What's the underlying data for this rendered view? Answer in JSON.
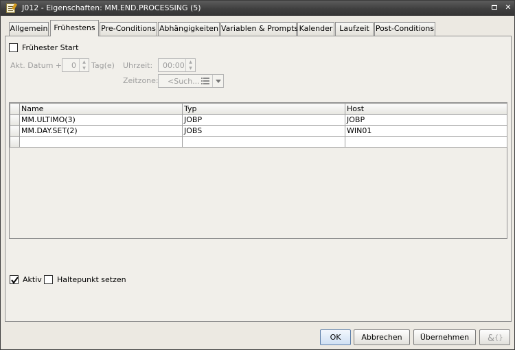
{
  "window": {
    "title": "J012 - Eigenschaften: MM.END.PROCESSING (5)",
    "close_glyph": "✕"
  },
  "tabs": [
    {
      "label": "Allgemein",
      "active": false
    },
    {
      "label": "Frühestens",
      "active": true
    },
    {
      "label": "Pre-Conditions",
      "active": false
    },
    {
      "label": "Abhängigkeiten",
      "active": false
    },
    {
      "label": "Variablen & Prompts",
      "active": false
    },
    {
      "label": "Kalender",
      "active": false
    },
    {
      "label": "Laufzeit",
      "active": false
    },
    {
      "label": "Post-Conditions",
      "active": false
    }
  ],
  "earliest": {
    "checkbox_label": "Frühester Start",
    "checked": false,
    "date_label": "Akt. Datum +:",
    "date_value": "0",
    "date_unit": "Tag(e)",
    "time_label": "Uhrzeit:",
    "time_value": "00:00",
    "timezone_label": "Zeitzone:",
    "timezone_placeholder": "<Such..."
  },
  "table": {
    "columns": [
      "Name",
      "Typ",
      "Host"
    ],
    "rows": [
      [
        "MM.ULTIMO(3)",
        "JOBP",
        "JOBP"
      ],
      [
        "MM.DAY.SET(2)",
        "JOBS",
        "WIN01"
      ],
      [
        "",
        "",
        ""
      ]
    ]
  },
  "flags": {
    "active_label": "Aktiv",
    "active_checked": true,
    "breakpoint_label": "Haltepunkt setzen",
    "breakpoint_checked": false
  },
  "buttons": {
    "ok": "OK",
    "cancel": "Abbrechen",
    "apply": "Übernehmen"
  }
}
